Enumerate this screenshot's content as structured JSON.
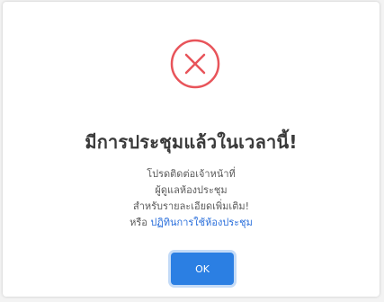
{
  "dialog": {
    "icon": "error-x-circle-icon",
    "accent_color": "#e8545a",
    "title": "มีการประชุมแล้วในเวลานี้!",
    "message_lines": [
      "โปรดติดต่อเจ้าหน้าที่",
      "ผู้ดูแลห้องประชุม",
      "สำหรับรายละเอียดเพิ่มเติม!"
    ],
    "or_text": "หรือ",
    "link_text": "ปฏิทินการใช้ห้องประชุม",
    "link_color": "#2a6fdb",
    "ok_label": "OK",
    "ok_color": "#2b7fe3"
  }
}
